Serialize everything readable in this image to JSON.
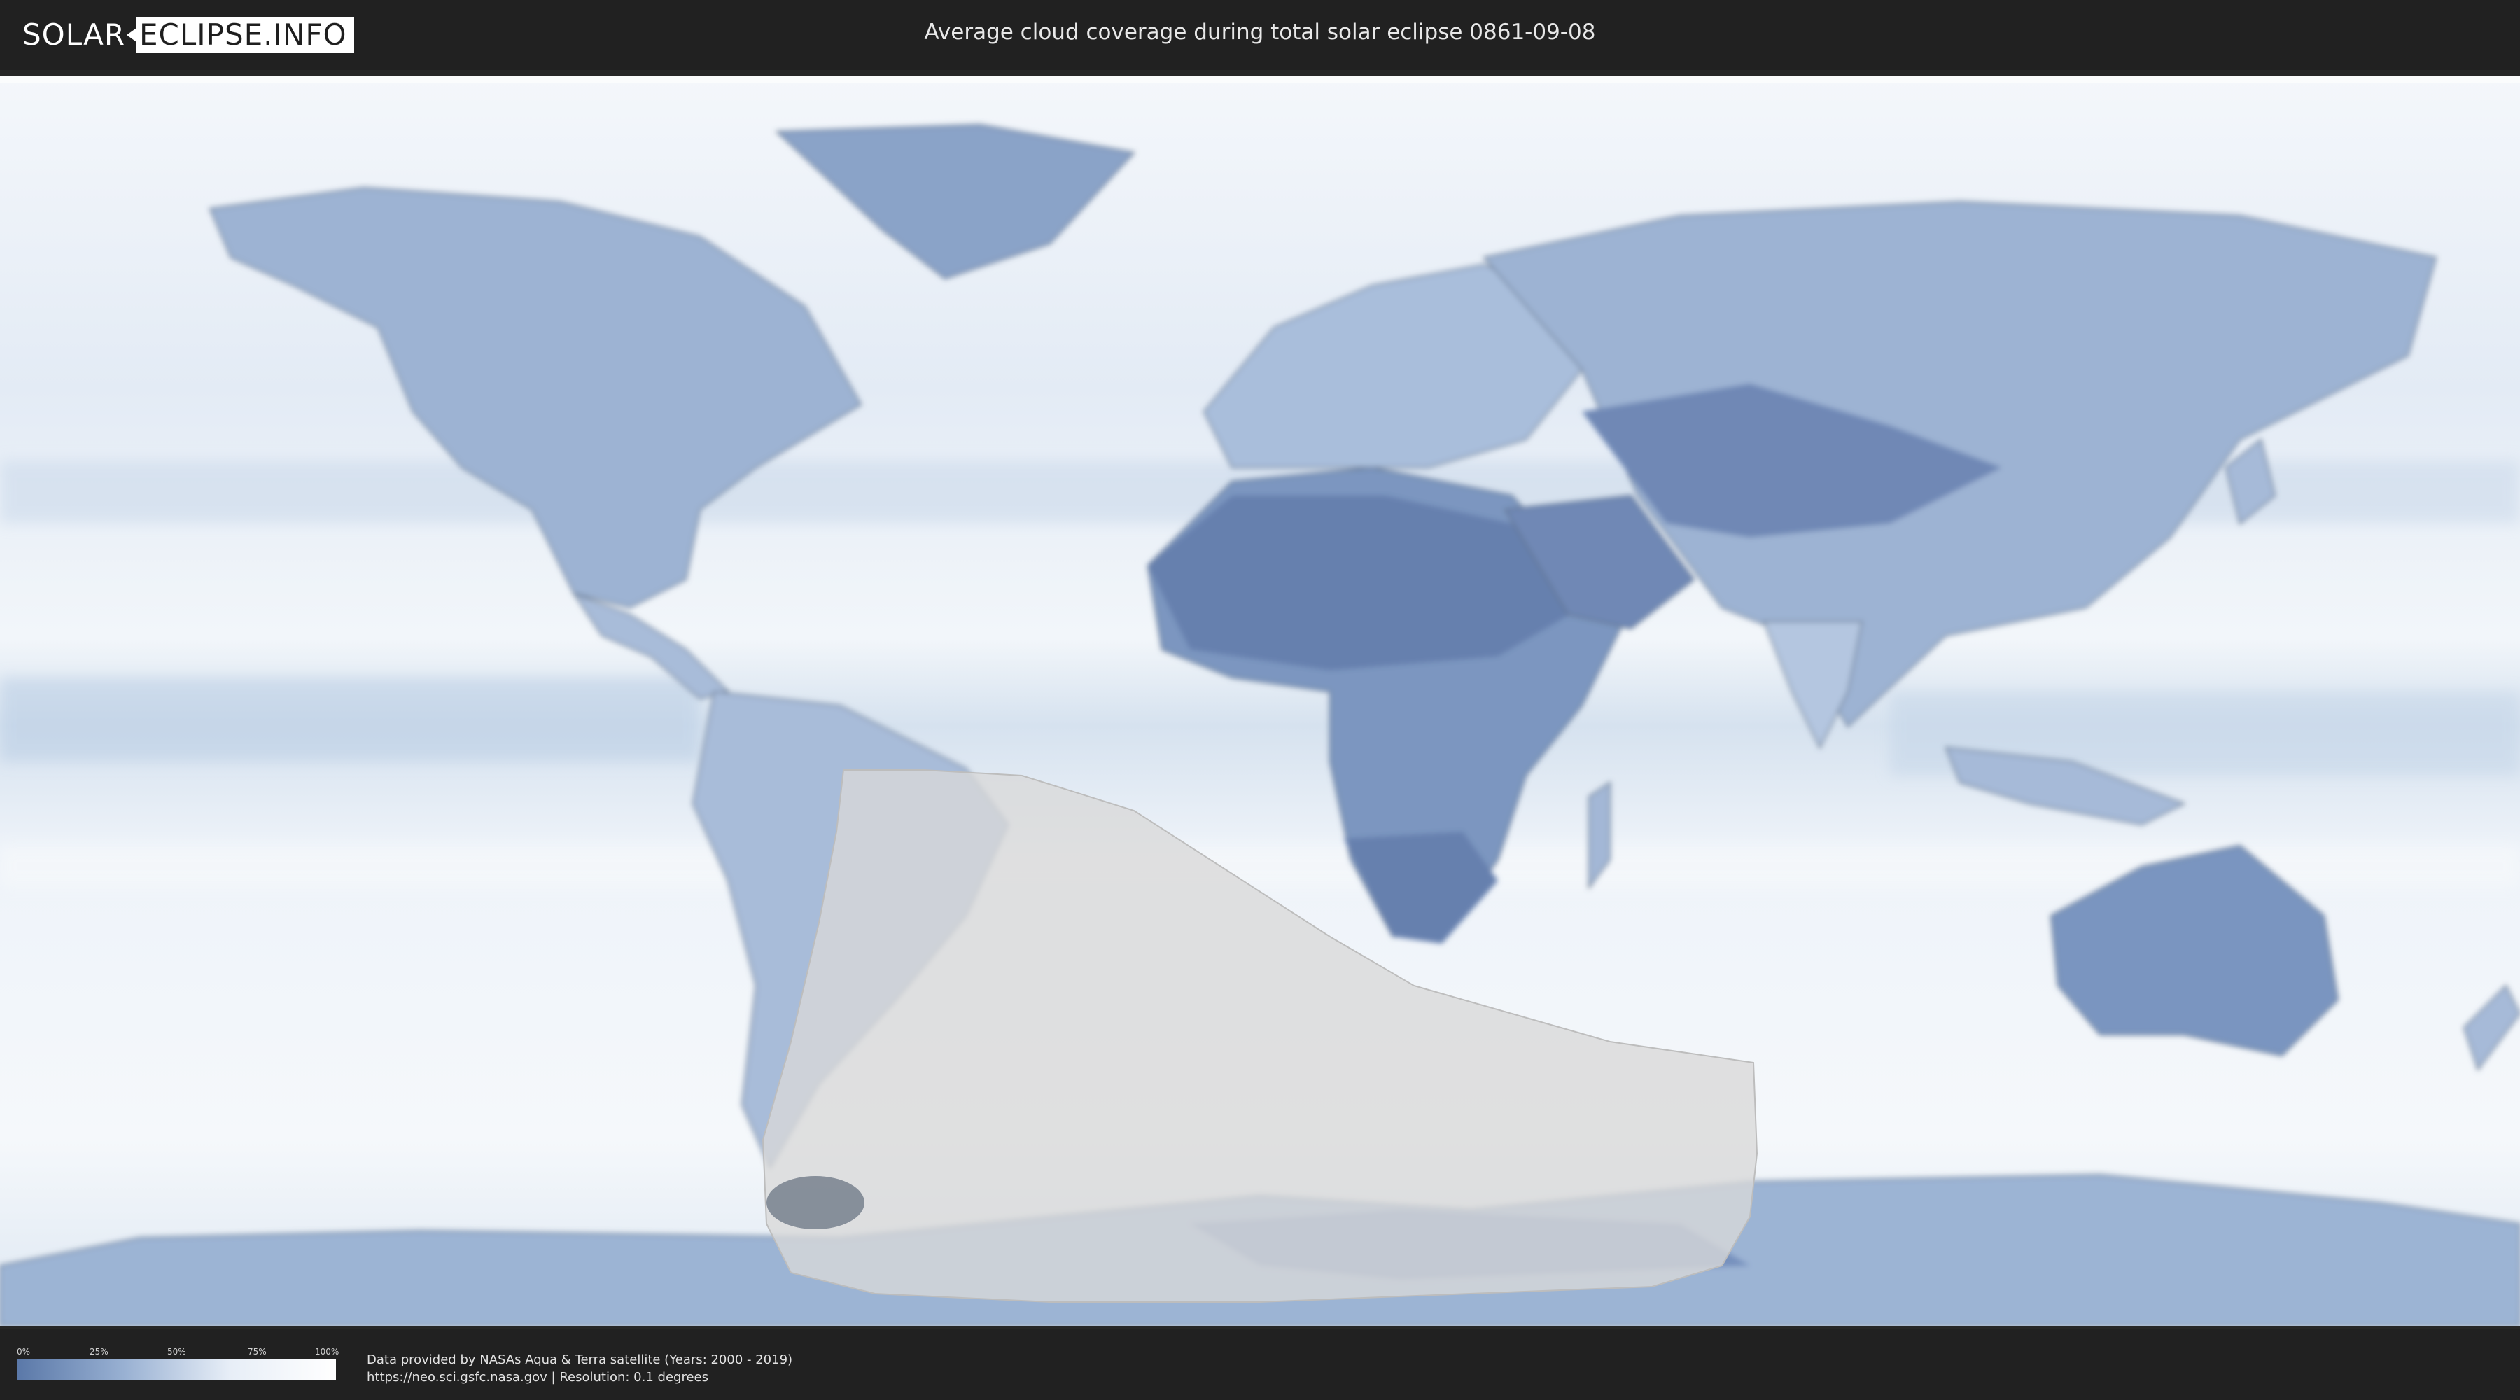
{
  "header": {
    "logo_left": "SOLAR",
    "logo_right": "ECLIPSE.INFO",
    "title": "Average cloud coverage during total solar eclipse 0861-09-08"
  },
  "legend": {
    "ticks": [
      "0%",
      "25%",
      "50%",
      "75%",
      "100%"
    ],
    "gradient_colors": [
      "#5a78a8",
      "#98b0d2",
      "#e7eef7",
      "#ffffff"
    ]
  },
  "footer": {
    "source_line": "Data provided by NASAs Aqua & Terra satellite (Years: 2000 - 2019)",
    "url_line": "https://neo.sci.gsfc.nasa.gov | Resolution: 0.1 degrees"
  },
  "map": {
    "land_color": "#6d87b3",
    "ocean_cloud_color": "#eef3f9",
    "eclipse_region_color": "#d9d9d9"
  }
}
